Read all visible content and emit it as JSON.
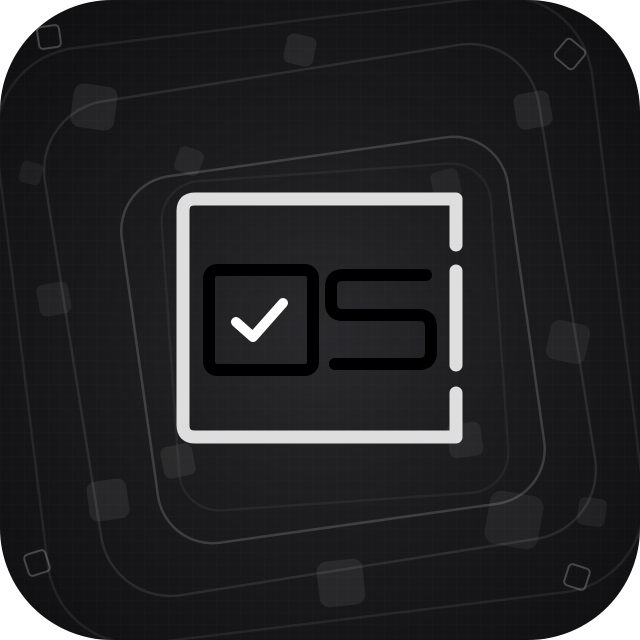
{
  "app_icon": {
    "logo_text": "OS",
    "logo_icon": "checkbox-check-icon",
    "colors": {
      "frame": "#dedede",
      "glyph": "#000000",
      "check": "#ffffff"
    }
  }
}
